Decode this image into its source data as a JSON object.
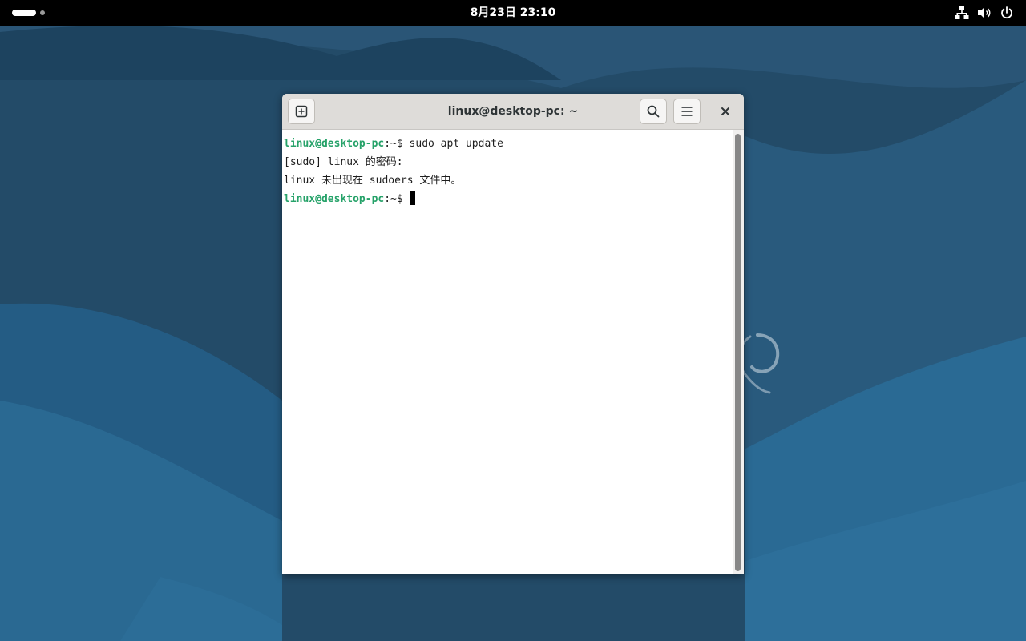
{
  "topbar": {
    "clock": "8月23日  23:10",
    "tray_icons": [
      "network-icon",
      "volume-icon",
      "power-icon"
    ]
  },
  "terminal": {
    "title": "linux@desktop-pc: ~",
    "lines": [
      {
        "user": "linux@desktop-pc",
        "path": ":~$",
        "text": " sudo apt update"
      },
      {
        "text": "[sudo] linux 的密码:"
      },
      {
        "text": "linux 未出现在 sudoers 文件中。"
      },
      {
        "user": "linux@desktop-pc",
        "path": ":~$",
        "text": " "
      }
    ]
  },
  "colors": {
    "topbar": "#000000",
    "prompt_green": "#26a269",
    "headerbar": "#dedcd9",
    "wallpaper_base": "#1f4f72"
  }
}
